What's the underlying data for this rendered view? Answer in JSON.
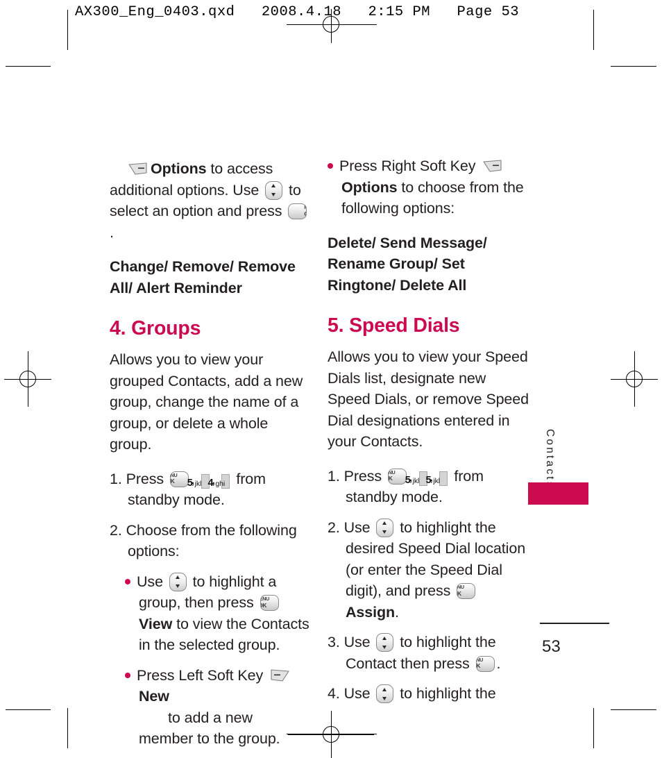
{
  "print_marks": {
    "header_line": "AX300_Eng_0403.qxd   2008.4.18   2:15 PM   Page 53"
  },
  "page": {
    "folio": "53",
    "side_tab_label": "Contacts",
    "accent_color": "#cc0a4e",
    "text_color": "#231f20"
  },
  "keys": {
    "menu_ok_line1": "MENU",
    "menu_ok_line2": "OK",
    "nav_name": "navigation-up-down-key",
    "num_5": {
      "digit": "5",
      "letters": "jkl"
    },
    "num_4": {
      "digit": "4",
      "letters": "ghi"
    }
  },
  "left_column": {
    "continued_para": {
      "part1": "Options",
      "part2": " to access additional options. Use ",
      "part3": " to select an option and press ",
      "part4": "."
    },
    "options_list": "Change/ Remove/ Remove All/ Alert Reminder",
    "section": {
      "heading": "4. Groups",
      "intro": "Allows you to view your grouped Contacts, add a new group, change the name of a group, or delete a whole group.",
      "steps": [
        {
          "number": "1.",
          "text_before": "Press ",
          "text_mid1": ", ",
          "text_mid2": ", ",
          "text_after": " from standby mode."
        },
        {
          "number": "2.",
          "text": "Choose from the following options:"
        }
      ],
      "bullets": [
        {
          "text_before": "Use ",
          "text_mid": " to highlight a group, then press ",
          "bold_label": "View",
          "text_after": " to view the Contacts in the selected group."
        },
        {
          "text_before": "Press Left Soft Key ",
          "bold_label": "New",
          "text_after": " to add a new member to the group."
        }
      ]
    }
  },
  "right_column": {
    "bullet_top": {
      "text_before": "Press Right Soft Key ",
      "bold_label": "Options",
      "text_after": " to choose from the following options:"
    },
    "options_list": "Delete/ Send Message/ Rename Group/ Set Ringtone/ Delete All",
    "section": {
      "heading": "5. Speed Dials",
      "intro": "Allows you to view your Speed Dials list, designate new Speed Dials, or remove Speed Dial designations entered in your Contacts.",
      "steps": [
        {
          "number": "1.",
          "text_before": "Press ",
          "text_mid1": ", ",
          "text_mid2": ", ",
          "text_after": " from standby mode."
        },
        {
          "number": "2.",
          "text_before": "Use ",
          "text_mid": " to highlight the desired Speed Dial location (or enter the Speed Dial digit), and press ",
          "bold_label": "Assign",
          "text_after": "."
        },
        {
          "number": "3.",
          "text_before": "Use ",
          "text_mid": " to highlight the Contact then press ",
          "text_after": "."
        },
        {
          "number": "4.",
          "text_before": "Use ",
          "text_mid": " to highlight the"
        }
      ]
    }
  }
}
